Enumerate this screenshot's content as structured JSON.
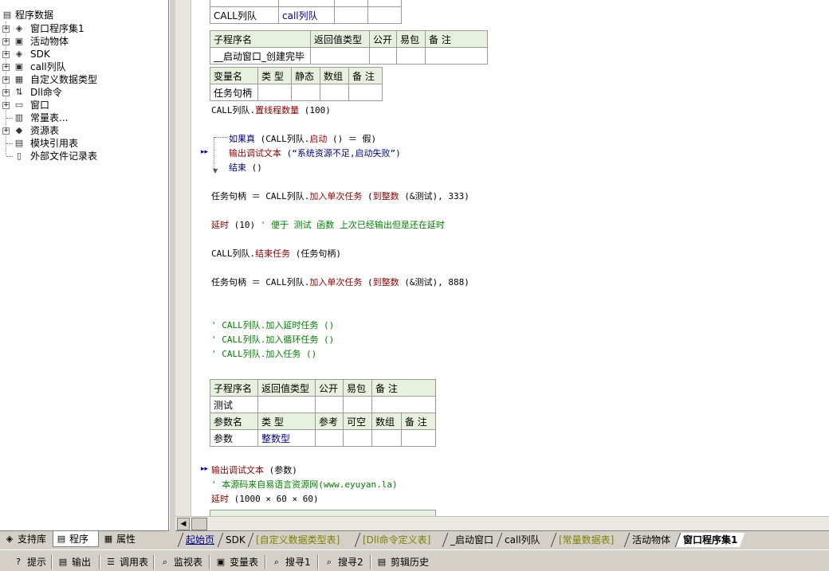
{
  "tree": {
    "root": "程序数据",
    "items": [
      {
        "label": "窗口程序集1",
        "icon": "assembly-icon",
        "expandable": true
      },
      {
        "label": "活动物体",
        "icon": "class-icon",
        "expandable": true
      },
      {
        "label": "SDK",
        "icon": "assembly-icon",
        "expandable": true
      },
      {
        "label": "call列队",
        "icon": "class-icon",
        "expandable": true
      },
      {
        "label": "自定义数据类型",
        "icon": "datatype-icon",
        "expandable": true
      },
      {
        "label": "Dll命令",
        "icon": "dll-icon",
        "expandable": true
      },
      {
        "label": "窗口",
        "icon": "window-icon",
        "expandable": true
      },
      {
        "label": "常量表...",
        "icon": "constant-icon",
        "expandable": false
      },
      {
        "label": "资源表",
        "icon": "resource-icon",
        "expandable": true
      },
      {
        "label": "模块引用表",
        "icon": "module-icon",
        "expandable": false
      },
      {
        "label": "外部文件记录表",
        "icon": "file-icon",
        "expandable": false
      }
    ]
  },
  "editor": {
    "top_table": {
      "col1": "CALL列队",
      "col2": "call列队"
    },
    "sub1": {
      "headers": [
        "子程序名",
        "返回值类型",
        "公开",
        "易包",
        "备 注"
      ],
      "name": "__启动窗口_创建完毕"
    },
    "var1": {
      "headers": [
        "变量名",
        "类 型",
        "静态",
        "数组",
        "备 注"
      ],
      "name": "任务句柄"
    },
    "lines": {
      "l1_obj": "CALL列队.",
      "l1_fn": "置线程数量",
      "l1_arg": " (100)",
      "if_kw": "如果真",
      "if_cond_a": " (CALL列队.",
      "if_cond_fn": "启动",
      "if_cond_b": " () ＝ 假)",
      "if_body_fn": "输出调试文本",
      "if_body_str": " (“系统资源不足,启动失败”)",
      "end_kw": "结束",
      "end_arg": " ()",
      "l2_a": "任务句柄 ＝ CALL列队.",
      "l2_fn": "加入单次任务",
      "l2_b": " (",
      "l2_fn2": "到整数",
      "l2_c": " (&测试), 333)",
      "l3_fn": "延时",
      "l3_arg": " (10)",
      "l3_cm": "  ' 便于 测试 函数 上次已经输出但是还在延时",
      "l4_obj": "CALL列队.",
      "l4_fn": "结束任务",
      "l4_arg": " (任务句柄)",
      "l5_a": "任务句柄 ＝ CALL列队.",
      "l5_fn": "加入单次任务",
      "l5_b": " (",
      "l5_fn2": "到整数",
      "l5_c": " (&测试), 888)",
      "c1": "' CALL列队.加入延时任务 ()",
      "c2": "' CALL列队.加入循环任务 ()",
      "c3": "' CALL列队.加入任务 ()"
    },
    "sub2": {
      "headers": [
        "子程序名",
        "返回值类型",
        "公开",
        "易包",
        "备 注"
      ],
      "name": "测试",
      "param_headers": [
        "参数名",
        "类 型",
        "参考",
        "可空",
        "数组",
        "备 注"
      ],
      "param_name": "参数",
      "param_type": "整数型"
    },
    "lines2": {
      "o_fn": "输出调试文本",
      "o_arg": " (参数)",
      "cm": "' 本源码来自易语言资源网(www.eyuyan.la)",
      "d_fn": "延时",
      "d_arg": " (1000 × 60 × 60)"
    }
  },
  "left_tabs": [
    {
      "label": "支持库",
      "icon": "library-icon"
    },
    {
      "label": "程序",
      "icon": "program-icon",
      "active": true
    },
    {
      "label": "属性",
      "icon": "property-icon"
    }
  ],
  "editor_tabs": [
    {
      "label": "起始页",
      "color": "#00008b"
    },
    {
      "label": "SDK",
      "color": "#000"
    },
    {
      "label": "[自定义数据类型表]",
      "color": "#808000"
    },
    {
      "label": "[Dll命令定义表]",
      "color": "#808000"
    },
    {
      "label": "_启动窗口",
      "color": "#000"
    },
    {
      "label": "call列队",
      "color": "#000"
    },
    {
      "label": "[常量数据表]",
      "color": "#808000"
    },
    {
      "label": "活动物体",
      "color": "#000"
    },
    {
      "label": "窗口程序集1",
      "color": "#000",
      "active": true
    }
  ],
  "toolbar": [
    {
      "label": "提示",
      "icon": "hint-icon"
    },
    {
      "label": "输出",
      "icon": "output-icon"
    },
    {
      "label": "调用表",
      "icon": "callstack-icon"
    },
    {
      "label": "监视表",
      "icon": "watch-icon"
    },
    {
      "label": "变量表",
      "icon": "variable-icon"
    },
    {
      "label": "搜寻1",
      "icon": "search-icon"
    },
    {
      "label": "搜寻2",
      "icon": "search-icon"
    },
    {
      "label": "剪辑历史",
      "icon": "clipboard-icon"
    }
  ]
}
